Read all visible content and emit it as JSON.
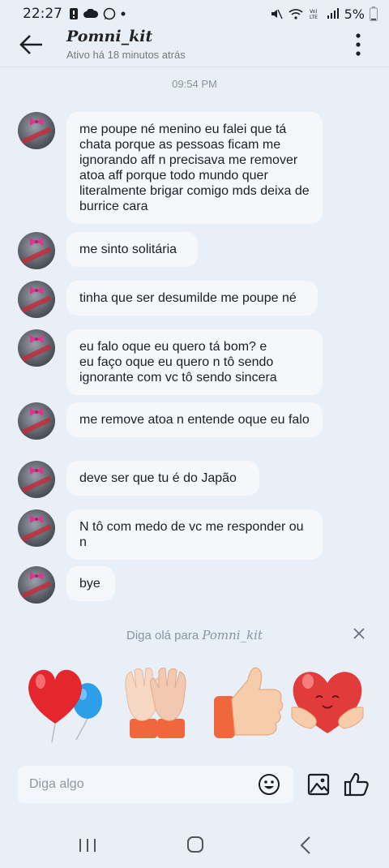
{
  "status_bar": {
    "time": "22:27",
    "battery": "5%"
  },
  "header": {
    "title": "Pomni_kit",
    "subtitle": "Ativo há 18 minutos atrás"
  },
  "timestamp": "09:54 PM",
  "messages": [
    {
      "text": "me poupe né menino eu falei que tá chata porque as pessoas ficam me ignorando aff n precisava me remover atoa aff porque todo mundo quer literalmente brigar comigo mds deixa de burrice cara"
    },
    {
      "text": "me sinto solitária"
    },
    {
      "text": "tinha que ser desumilde me poupe né"
    },
    {
      "text": "eu falo oque eu quero tá bom? e\neu faço oque eu quero n tô sendo ignorante com vc tô sendo sincera"
    },
    {
      "text": "me remove atoa n entende oque eu falo"
    },
    {
      "text": "deve ser que tu  é do Japão"
    },
    {
      "text": "N tô com medo de vc me responder ou n"
    },
    {
      "text": "bye"
    }
  ],
  "greeting": {
    "prefix": "Diga olá para ",
    "name": "Pomni_kit"
  },
  "stickers": [
    "heart-balloons-sticker",
    "waving-hands-sticker",
    "thumbs-up-sticker",
    "hugging-heart-sticker"
  ],
  "input": {
    "placeholder": "Diga algo"
  },
  "colors": {
    "background": "#e9eff7",
    "bubble": "#f5f7fb"
  }
}
